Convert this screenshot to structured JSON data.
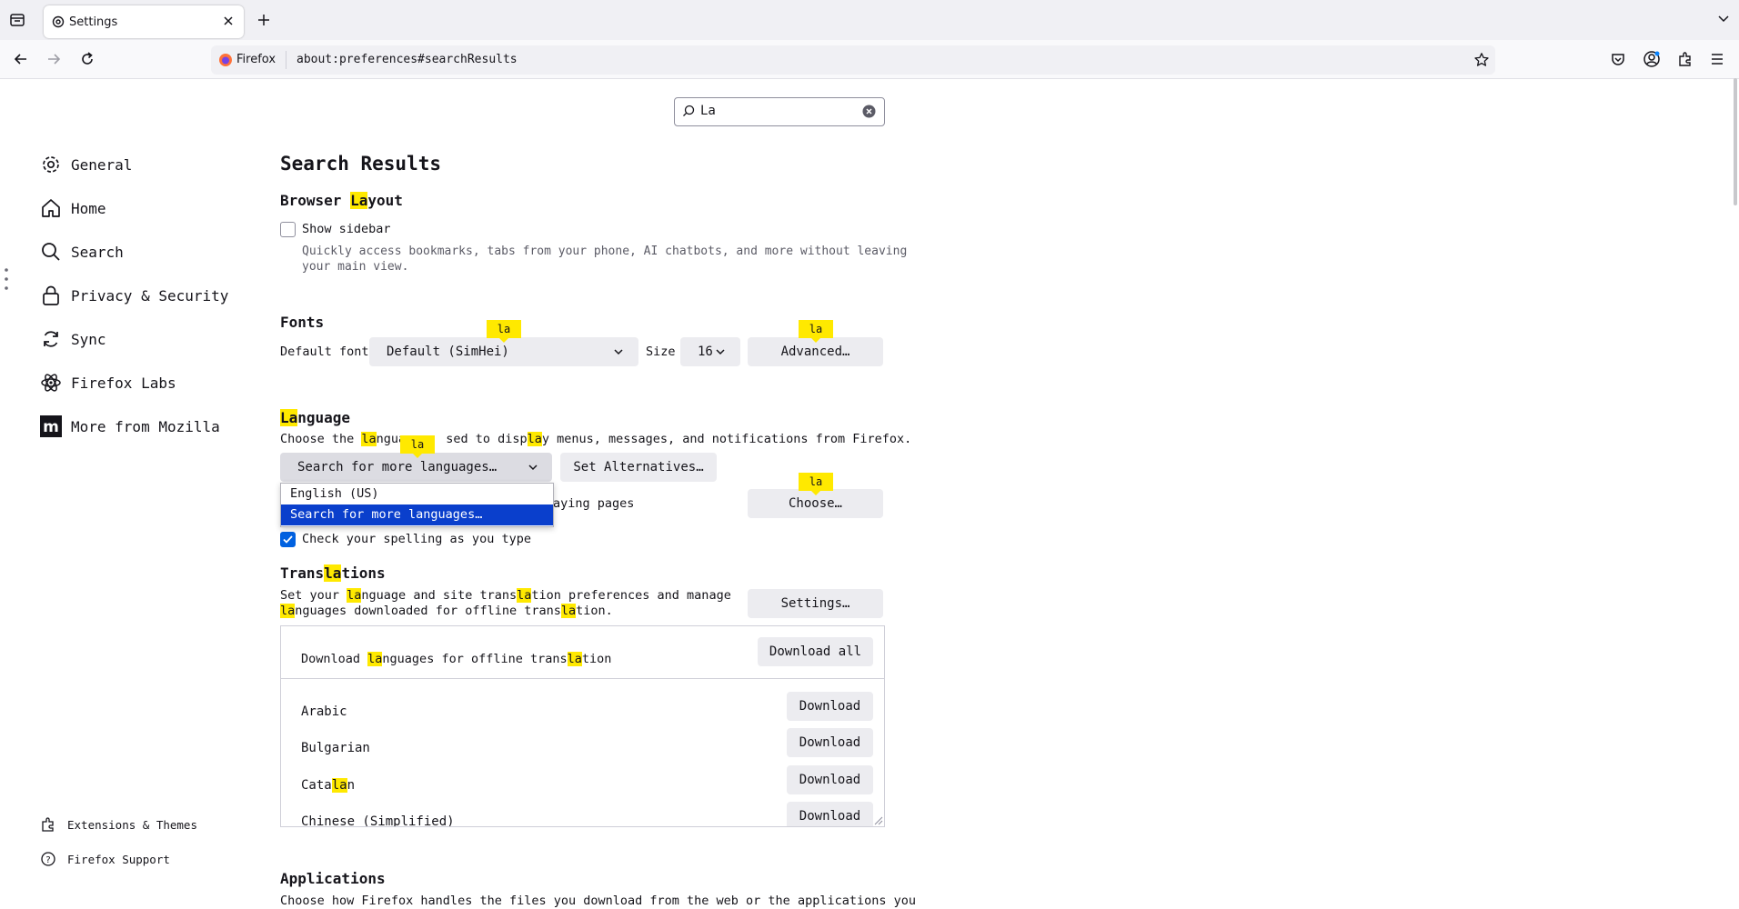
{
  "window": {
    "tab_title": "Settings",
    "identity_label": "Firefox",
    "url": "about:preferences#searchResults"
  },
  "search": {
    "value": "La"
  },
  "sidebar": {
    "categories": [
      {
        "label": "General",
        "icon": "gear-icon"
      },
      {
        "label": "Home",
        "icon": "home-icon"
      },
      {
        "label": "Search",
        "icon": "search-icon"
      },
      {
        "label": "Privacy & Security",
        "icon": "lock-icon"
      },
      {
        "label": "Sync",
        "icon": "sync-icon"
      },
      {
        "label": "Firefox Labs",
        "icon": "labs-icon"
      },
      {
        "label": "More from Mozilla",
        "icon": "mozilla-icon"
      }
    ],
    "bottom": [
      {
        "label": "Extensions & Themes",
        "icon": "puzzle-icon"
      },
      {
        "label": "Firefox Support",
        "icon": "help-icon"
      }
    ]
  },
  "main": {
    "title": "Search Results",
    "layout": {
      "heading_pre": "Browser ",
      "heading_hl": "La",
      "heading_post": "yout",
      "show_sidebar_label": "Show sidebar",
      "show_sidebar_checked": false,
      "desc_line1": "Quickly access bookmarks, tabs from your phone, AI chatbots, and more without leaving",
      "desc_line2": "your main view."
    },
    "fonts": {
      "heading": "Fonts",
      "default_font_label": "Default font",
      "default_font_value": "Default (SimHei)",
      "size_label": "Size",
      "size_value": "16",
      "advanced_label": "Advanced…",
      "tooltip": "la"
    },
    "language": {
      "heading_hl": "La",
      "heading_post": "nguage",
      "desc_pre": "Choose the ",
      "desc_hl1": "la",
      "desc_mid1": "ngua",
      "desc_mid2": "sed to disp",
      "desc_hl2": "la",
      "desc_post": "y menus, messages, and notifications from Firefox.",
      "select_value": "Search for more languages…",
      "set_alternatives_label": "Set Alternatives…",
      "dropdown_options": [
        "English (US)",
        "Search for more languages…"
      ],
      "pages_fragment": "aying pages",
      "choose_label": "Choose…",
      "spell_label": "Check your spelling as you type",
      "spell_checked": true,
      "tooltip": "la"
    },
    "translations": {
      "heading_pre": "Trans",
      "heading_hl": "la",
      "heading_post": "tions",
      "desc1_pre": "Set your ",
      "desc1_hl": "la",
      "desc1_mid": "nguage and site trans",
      "desc1_hl2": "la",
      "desc1_post": "tion preferences and manage",
      "desc2_hl": "la",
      "desc2_mid": "nguages downloaded for offline trans",
      "desc2_hl2": "la",
      "desc2_post": "tion.",
      "settings_label": "Settings…",
      "download_header_pre": "Download ",
      "download_header_hl": "la",
      "download_header_mid": "nguages for offline trans",
      "download_header_hl2": "la",
      "download_header_post": "tion",
      "download_all_label": "Download all",
      "languages": [
        {
          "name": "Arabic",
          "button": "Download"
        },
        {
          "name": "Bulgarian",
          "button": "Download"
        },
        {
          "name_pre": "Cata",
          "name_hl": "la",
          "name_post": "n",
          "button": "Download"
        },
        {
          "name": "Chinese (Simplified)",
          "button": "Download"
        }
      ]
    },
    "applications": {
      "heading": "Applications",
      "desc": "Choose how Firefox handles the files you download from the web or the applications you"
    }
  }
}
